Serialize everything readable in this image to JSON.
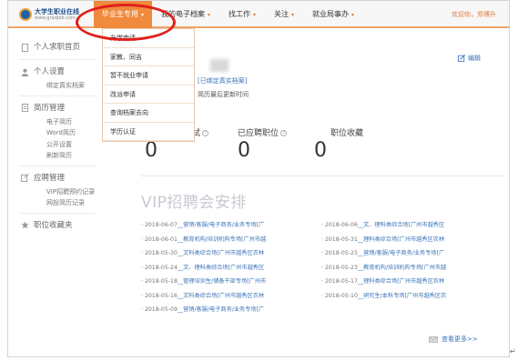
{
  "header": {
    "logo_text": "大学生职业在线",
    "logo_sub": "www.gradjob.com",
    "welcome": "欢迎你，郑博升"
  },
  "nav": {
    "items": [
      {
        "label": "毕业生专用"
      },
      {
        "label": "我的电子档案"
      },
      {
        "label": "找工作"
      },
      {
        "label": "关注"
      },
      {
        "label": "就业局事办"
      }
    ]
  },
  "dropdown": {
    "items": [
      {
        "label": "升学申请"
      },
      {
        "label": "家教、同吉"
      },
      {
        "label": "暂不就业申请"
      },
      {
        "label": "改派申请"
      },
      {
        "label": "查询档案去向"
      },
      {
        "label": "学历认证"
      }
    ]
  },
  "sidebar": {
    "home": "个人求职首页",
    "settings": "个人设置",
    "settings_sub": [
      "绑定真实档案"
    ],
    "resume": "简历管理",
    "resume_sub": [
      "电子简历",
      "Word简历",
      "公开设置",
      "刷新简历"
    ],
    "apply": "应聘管理",
    "apply_sub": [
      "VIP招聘预约记录",
      "网投简历记录"
    ],
    "favorites": "职位收藏夹"
  },
  "profile": {
    "edit": "编辑",
    "bound": "[已绑定真实档案]",
    "updated": "简历最后更新时间"
  },
  "stats": [
    {
      "label": "试",
      "value": "0"
    },
    {
      "label": "已应聘职位",
      "value": "0"
    },
    {
      "label": "职位收藏",
      "value": "0"
    }
  ],
  "vip": {
    "title": "VIP招聘会安排",
    "more": "查看更多>>",
    "jobs": [
      {
        "date": "2018-06-07",
        "text": "__营销/客服/电子商务/业务专场[广"
      },
      {
        "date": "2018-06-06",
        "text": "__文、理科类综合场[广州市越秀区"
      },
      {
        "date": "2018-06-01",
        "text": "__教育机构/培训机构专场[广州市越"
      },
      {
        "date": "2018-05-31",
        "text": "__理科类综合场[广州市越秀区农林"
      },
      {
        "date": "2018-05-30",
        "text": "__文科类综合场[广州市越秀区农林"
      },
      {
        "date": "2018-05-25",
        "text": "__营销/客服/电子商务/业务专场[广"
      },
      {
        "date": "2018-05-24",
        "text": "__文、理科类综合场[广州市越秀区"
      },
      {
        "date": "2018-05-23",
        "text": "__教育机构/培训机构专场[广州市越"
      },
      {
        "date": "2018-05-18",
        "text": "__管理培训生/储备干部专场[广州市"
      },
      {
        "date": "2018-05-17",
        "text": "__理科类综合场[广州市越秀区农林"
      },
      {
        "date": "2018-05-16",
        "text": "__文科类综合场[广州市越秀区农林"
      },
      {
        "date": "2018-05-10",
        "text": "__研究生/本科专场[广州市越秀区农"
      },
      {
        "date": "2018-05-09",
        "text": "__营销/客服/电子商务/业务专场[广"
      }
    ]
  },
  "colors": {
    "accent": "#f08a3c",
    "link": "#3b74b9",
    "highlight": "#e0201b"
  }
}
